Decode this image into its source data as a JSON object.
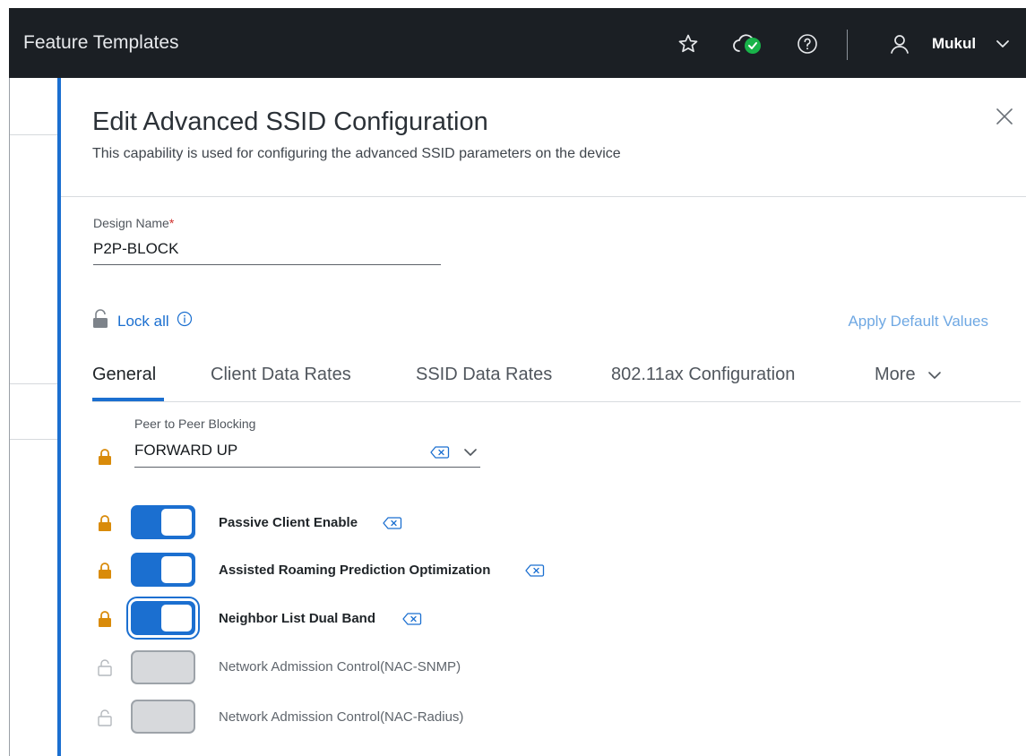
{
  "topbar": {
    "title": "Feature Templates",
    "icons": [
      "star-icon",
      "cloud-check-icon",
      "help-icon",
      "user-icon",
      "chevron-down-icon"
    ],
    "user_name": "Mukul"
  },
  "panel": {
    "title": "Edit Advanced SSID Configuration",
    "subtitle": "This capability is used for configuring the advanced SSID parameters on the device",
    "design_name": {
      "label": "Design Name",
      "required_mark": "*",
      "value": "P2P-BLOCK"
    },
    "lock_all_label": "Lock all",
    "apply_defaults_label": "Apply Default Values",
    "tabs": [
      {
        "label": "General",
        "active": true
      },
      {
        "label": "Client Data Rates",
        "active": false
      },
      {
        "label": "SSID Data Rates",
        "active": false
      },
      {
        "label": "802.11ax Configuration",
        "active": false
      },
      {
        "label": "More",
        "active": false
      }
    ],
    "peer_blocking": {
      "label": "Peer to Peer Blocking",
      "value": "FORWARD UP"
    },
    "toggles": [
      {
        "label": "Passive Client Enable",
        "enabled": true,
        "locked": true
      },
      {
        "label": "Assisted Roaming Prediction Optimization",
        "enabled": true,
        "locked": true
      },
      {
        "label": "Neighbor List Dual Band",
        "enabled": true,
        "locked": true
      },
      {
        "label": "Network Admission Control(NAC-SNMP)",
        "enabled": false,
        "locked": false
      },
      {
        "label": "Network Admission Control(NAC-Radius)",
        "enabled": false,
        "locked": false
      }
    ]
  },
  "colors": {
    "accent": "#1b6fd0",
    "lock_active": "#d98b0a",
    "topbar_bg": "#1b1f24",
    "status_ok": "#19b34a"
  }
}
